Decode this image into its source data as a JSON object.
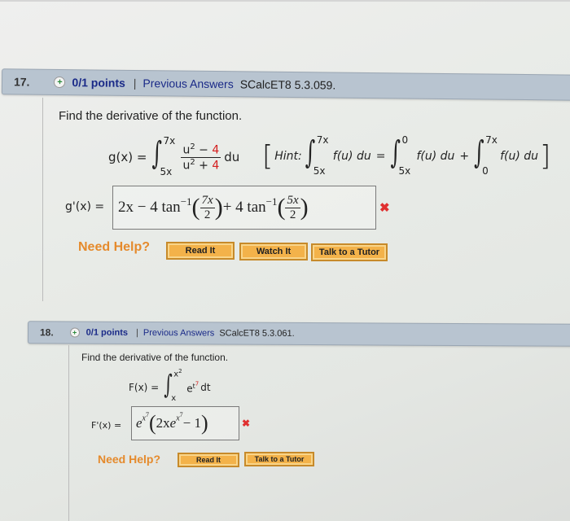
{
  "questions": [
    {
      "number": "17.",
      "plus_icon": "plus-circle-icon",
      "points": "0/1 points",
      "separator": "|",
      "previous_answers": "Previous Answers",
      "reference": "SCalcET8 5.3.059.",
      "prompt": "Find the derivative of the function.",
      "function": {
        "lhs": "g(x) =",
        "upper": "7x",
        "lower": "5x",
        "numerator_base": "u",
        "numerator_exp": "2",
        "numerator_op": " − ",
        "numerator_const": "4",
        "denominator_base": "u",
        "denominator_exp": "2",
        "denominator_op": " + ",
        "denominator_const": "4",
        "differential": "du"
      },
      "hint": {
        "label": "Hint:",
        "integrand": "f(u) du",
        "equals": "=",
        "plus": "+",
        "int1_upper": "7x",
        "int1_lower": "5x",
        "int2_upper": "0",
        "int2_lower": "5x",
        "int3_upper": "7x",
        "int3_lower": "0"
      },
      "answer_label": "g'(x) =",
      "answer": {
        "part1": "2x − 4 tan",
        "exp1": "−1",
        "frac1_num": "7x",
        "frac1_den": "2",
        "part2": " + 4 tan",
        "exp2": "−1",
        "frac2_num": "5x",
        "frac2_den": "2"
      },
      "status": "incorrect",
      "need_help": "Need Help?",
      "help_buttons": [
        "Read It",
        "Watch It",
        "Talk to a Tutor"
      ]
    },
    {
      "number": "18.",
      "plus_icon": "plus-circle-icon",
      "points": "0/1 points",
      "separator": "|",
      "previous_answers": "Previous Answers",
      "reference": "SCalcET8 5.3.061.",
      "prompt": "Find the derivative of the function.",
      "function": {
        "lhs": "F(x) =",
        "upper_base": "x",
        "upper_exp": "2",
        "lower": "x",
        "integrand_base": "e",
        "integrand_exp_base": "t",
        "integrand_exp_exp": "7",
        "differential": "dt"
      },
      "answer_label": "F'(x) =",
      "answer": {
        "e": "e",
        "exp": "x",
        "exp_sup": "7",
        "inner_start": "2x",
        "inner_e": "e",
        "inner_exp": "x",
        "inner_exp_sup": "7",
        "inner_end": " − 1"
      },
      "status": "incorrect",
      "need_help": "Need Help?",
      "help_buttons": [
        "Read It",
        "Talk to a Tutor"
      ]
    }
  ],
  "x_mark_glyph": "✖",
  "plus_glyph": "+"
}
